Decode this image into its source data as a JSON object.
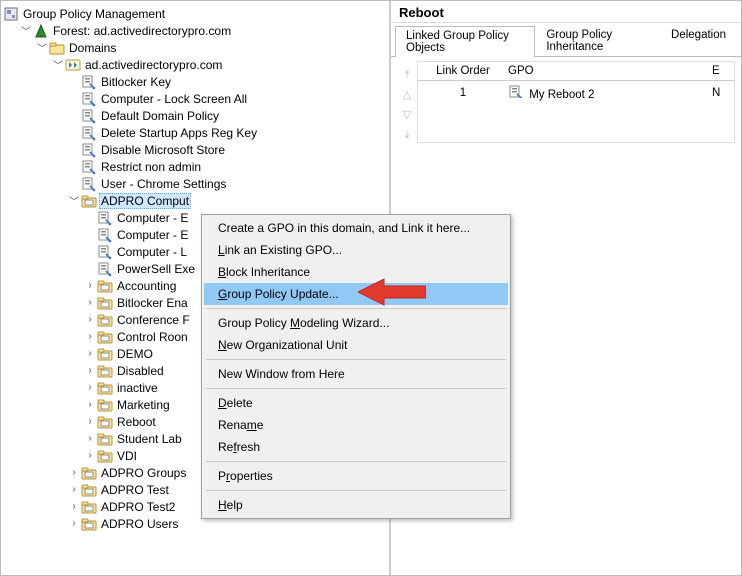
{
  "leftPane": {
    "title": "Group Policy Management",
    "forestPrefix": "Forest: ",
    "forestDomain": "ad.activedirectorypro.com",
    "domainsLabel": "Domains",
    "domainName": "ad.activedirectorypro.com",
    "gpos": {
      "bitlockerKey": "Bitlocker Key",
      "lockScreen": "Computer - Lock Screen All",
      "defaultDomain": "Default Domain Policy",
      "deleteStartup": "Delete Startup Apps Reg Key",
      "disableStore": "Disable Microsoft Store",
      "restrictNonAdmin": "Restrict non admin",
      "chrome": "User - Chrome Settings"
    },
    "selectedOU": "ADPRO Comput",
    "ouChildren": {
      "c1": "Computer - E",
      "c2": "Computer - E",
      "c3": "Computer - L",
      "c4": "PowerSell Exe"
    },
    "ous": {
      "accounting": "Accounting",
      "bitlockerEna": "Bitlocker Ena",
      "conference": "Conference F",
      "controlRoom": "Control Roon",
      "demo": "DEMO",
      "disabled": "Disabled",
      "inactive": "inactive",
      "marketing": "Marketing",
      "reboot": "Reboot",
      "studentLab": "Student Lab",
      "vdi": "VDI"
    },
    "bottomOUs": {
      "groups": "ADPRO Groups",
      "test": "ADPRO Test",
      "test2": "ADPRO Test2",
      "users": "ADPRO Users"
    }
  },
  "rightPane": {
    "title": "Reboot",
    "tabs": {
      "linked": "Linked Group Policy Objects",
      "inheritance": "Group Policy Inheritance",
      "delegation": "Delegation"
    },
    "cols": {
      "order": "Link Order",
      "gpo": "GPO",
      "e": "E"
    },
    "row": {
      "order": "1",
      "name": "My Reboot 2",
      "e": "N"
    }
  },
  "contextMenu": {
    "createGPO": "Create a GPO in this domain, and Link it here...",
    "linkExisting": {
      "pre": "",
      "u": "L",
      "post": "ink an Existing GPO..."
    },
    "blockInh": {
      "pre": "",
      "u": "B",
      "post": "lock Inheritance"
    },
    "gpUpdate": {
      "pre": "",
      "u": "G",
      "post": "roup Policy Update..."
    },
    "modeling": {
      "pre": "Group Policy ",
      "u": "M",
      "post": "odeling Wizard..."
    },
    "newOU": {
      "pre": "",
      "u": "N",
      "post": "ew Organizational Unit"
    },
    "newWindow": "New Window from Here",
    "delete": {
      "pre": "",
      "u": "D",
      "post": "elete"
    },
    "rename": {
      "pre": "Rena",
      "u": "m",
      "post": "e"
    },
    "refresh": {
      "pre": "Re",
      "u": "f",
      "post": "resh"
    },
    "properties": {
      "pre": "P",
      "u": "r",
      "post": "operties"
    },
    "help": {
      "pre": "",
      "u": "H",
      "post": "elp"
    }
  }
}
